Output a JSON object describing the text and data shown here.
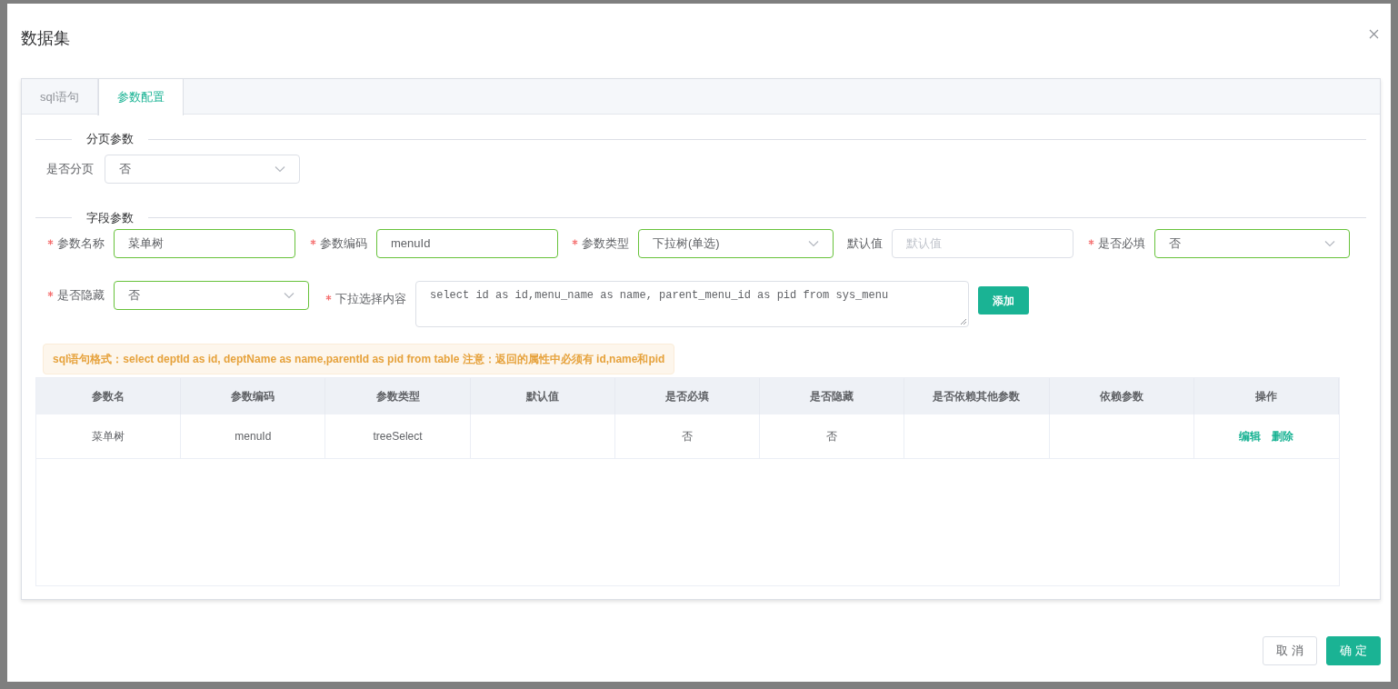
{
  "dialog": {
    "title": "数据集"
  },
  "tabs": [
    {
      "label": "sql语句",
      "selected": false
    },
    {
      "label": "参数配置",
      "selected": true
    }
  ],
  "paging_section": {
    "title": "分页参数",
    "field": {
      "label": "是否分页",
      "value": "否"
    }
  },
  "field_section": {
    "title": "字段参数",
    "form_rows": [
      {
        "fields": [
          {
            "kind": "input",
            "label": "参数名称",
            "required": true,
            "value": "菜单树",
            "validated": true
          },
          {
            "kind": "input",
            "label": "参数编码",
            "required": true,
            "value": "menuId",
            "validated": true
          },
          {
            "kind": "select",
            "label": "参数类型",
            "required": true,
            "value": "下拉树(单选)",
            "validated": true
          },
          {
            "kind": "input",
            "label": "默认值",
            "required": false,
            "placeholder": "默认值",
            "validated": false
          },
          {
            "kind": "select",
            "label": "是否必填",
            "required": true,
            "value": "否",
            "validated": true
          }
        ]
      },
      {
        "fields": [
          {
            "kind": "select",
            "label": "是否隐藏",
            "required": true,
            "value": "否",
            "validated": true
          },
          {
            "kind": "textarea",
            "label": "下拉选择内容",
            "required": true,
            "value": "select id as id,menu_name as name, parent_menu_id as pid from sys_menu",
            "validated": false
          },
          {
            "kind": "button",
            "label": "添加"
          }
        ]
      }
    ],
    "notice": "sql语句格式：select deptId as id, deptName as name,parentId as pid from table 注意：返回的属性中必须有 id,name和pid"
  },
  "table": {
    "columns": [
      "参数名",
      "参数编码",
      "参数类型",
      "默认值",
      "是否必填",
      "是否隐藏",
      "是否依赖其他参数",
      "依赖参数",
      "操作"
    ],
    "rows": [
      {
        "cells": [
          "菜单树",
          "menuId",
          "treeSelect",
          "",
          "否",
          "否",
          "",
          ""
        ],
        "actions": [
          "编辑",
          "删除"
        ]
      }
    ]
  },
  "footer": {
    "buttons": [
      {
        "label": "取 消",
        "kind": "secondary"
      },
      {
        "label": "确 定",
        "kind": "primary"
      }
    ]
  }
}
